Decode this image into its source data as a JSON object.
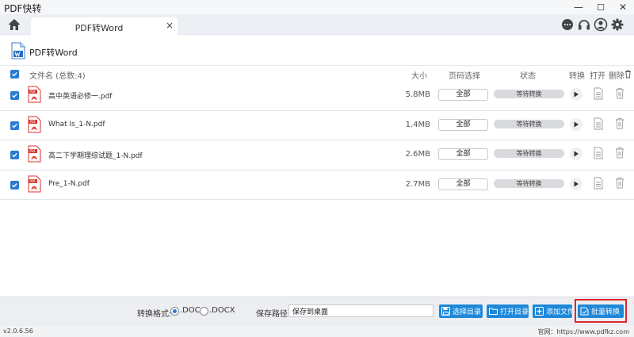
{
  "app": {
    "title": "PDF快转",
    "window_controls": {
      "minimize": "—",
      "maximize": "☐",
      "close": "✕"
    }
  },
  "tab": {
    "label": "PDF转Word",
    "close": "×"
  },
  "header": {
    "title": "PDF转Word"
  },
  "columns": {
    "name": "文件名 (总数:4)",
    "size": "大小",
    "page": "页码选择",
    "status": "状态",
    "convert": "转换",
    "open": "打开",
    "delete": "删除"
  },
  "files": [
    {
      "name": "高中英语必修一.pdf",
      "size": "5.8MB",
      "pages": "全部",
      "status": "等待转换",
      "checked": true
    },
    {
      "name": "What Is_1-N.pdf",
      "size": "1.4MB",
      "pages": "全部",
      "status": "等待转换",
      "checked": true
    },
    {
      "name": "高二下学期理综试题_1-N.pdf",
      "size": "2.6MB",
      "pages": "全部",
      "status": "等待转换",
      "checked": true
    },
    {
      "name": "Pre_1-N.pdf",
      "size": "2.7MB",
      "pages": "全部",
      "status": "等待转换",
      "checked": true
    }
  ],
  "bottom": {
    "format_label": "转换格式:",
    "format_doc": ".DOC",
    "format_docx": ".DOCX",
    "selected_format": ".DOC",
    "path_label": "保存路径:",
    "path_value": "保存到桌面",
    "btn_select_dir": "选择目录",
    "btn_open_dir": "打开目录",
    "btn_add_file": "添加文件",
    "btn_batch_convert": "批量转换"
  },
  "footer": {
    "version": "v2.0.6.56",
    "website": "官网：https://www.pdfkz.com"
  },
  "colors": {
    "accent": "#1e88d9",
    "highlight": "#e0262b",
    "pdf_red": "#d9322c"
  }
}
